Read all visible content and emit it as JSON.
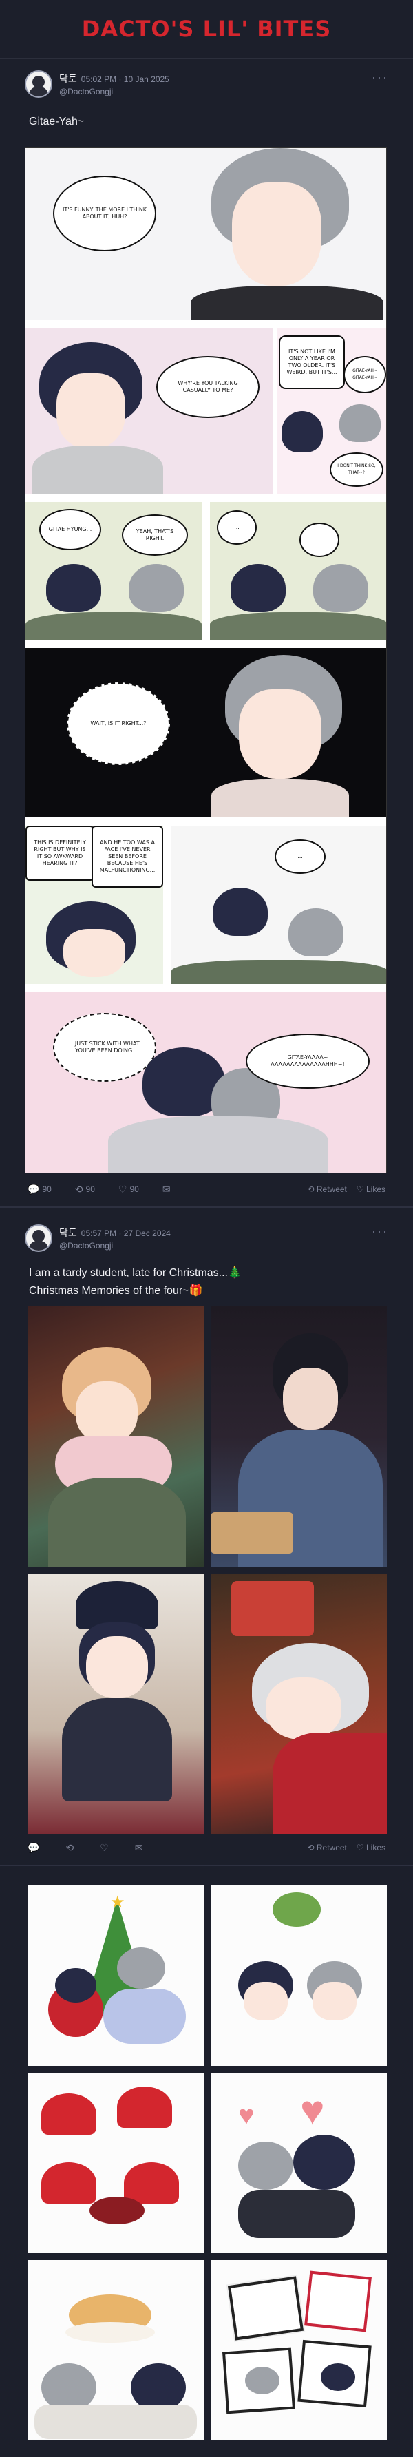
{
  "banner": {
    "title": "DACTO'S LIL' BITES"
  },
  "posts": [
    {
      "name": "닥토",
      "time": "05:02 PM · 10 Jan 2025",
      "handle": "@DactoGongji",
      "text": [
        "Gitae-Yah~"
      ],
      "actions": {
        "reply": "90",
        "retweet": "90",
        "like": "90",
        "share": "",
        "retweet_label": "Retweet",
        "likes_label": "Likes"
      },
      "comic": {
        "bubbles": [
          "It's funny. The more I think about it, huh?",
          "Why're you talking casually to me?",
          "It's not like I'm only a year or two older. It's weird, but it's...",
          "Gitae-yah~ Gitae-yah~",
          "I don't think so, that~?",
          "Gitae hyung...",
          "Yeah, that's right.",
          "...",
          "...",
          "Wait, is it right...?",
          "This is definitely right but why is it so awkward hearing it?",
          "And he too was a face I've never seen before because he's malfunctioning...",
          "...",
          "...Just stick with what you've been doing.",
          "Gitae-yaaaa~ Aaaaaaaaaaaaaahhh~!"
        ]
      }
    },
    {
      "name": "닥토",
      "time": "05:57 PM · 27 Dec 2024",
      "handle": "@DactoGongji",
      "text": [
        "I am a tardy student, late for Christmas...🎄",
        "Christmas Memories of the four~🎁"
      ],
      "actions": {
        "reply": "",
        "retweet": "",
        "like": "",
        "share": "",
        "retweet_label": "Retweet",
        "likes_label": "Likes"
      }
    }
  ],
  "icons": {
    "reply": "comment-icon",
    "retweet": "retweet-icon",
    "like": "heart-icon",
    "share": "share-icon"
  },
  "colors": {
    "background": "#1c1f2b",
    "brand": "#d6262e",
    "muted": "#8a8fa3"
  }
}
